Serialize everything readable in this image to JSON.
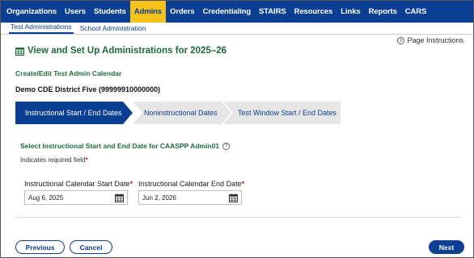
{
  "topnav": {
    "items": [
      "Organizations",
      "Users",
      "Students",
      "Admins",
      "Orders",
      "Credentialing",
      "STAIRS",
      "Resources",
      "Links",
      "Reports",
      "CARS"
    ],
    "active_index": 3
  },
  "subnav": {
    "items": [
      "Test Administrations",
      "School Administration"
    ],
    "active_index": 0
  },
  "page_instructions": "Page Instructions",
  "page_title": "View and Set Up Administrations for 2025–26",
  "section_title": "Create/Edit Test Admin Calendar",
  "district": "Demo CDE District Five (99999910000000)",
  "stepper": {
    "steps": [
      "Instructional Start / End Dates",
      "Noninstructional Dates",
      "Test Window Start / End Dates"
    ],
    "active_index": 0
  },
  "select_title": "Select Instructional Start and End Date for CAASPP Admin01",
  "required_note": "Indicates required field",
  "fields": {
    "start": {
      "label": "Instructional Calendar Start Date",
      "value": "Aug 6, 2025"
    },
    "end": {
      "label": "Instructional Calendar End Date",
      "value": "Jun 2, 2026"
    }
  },
  "buttons": {
    "previous": "Previous",
    "cancel": "Cancel",
    "next": "Next"
  },
  "colors": {
    "nav_blue": "#0a3f93",
    "active_tab": "#f7c21a",
    "heading_green": "#1f6b3a",
    "required_red": "#c0262c",
    "step_inactive": "#e6e6e6"
  },
  "icons": {
    "title": "calendar-grid-icon",
    "date": "calendar-icon",
    "info": "info-icon",
    "help": "help-icon"
  }
}
